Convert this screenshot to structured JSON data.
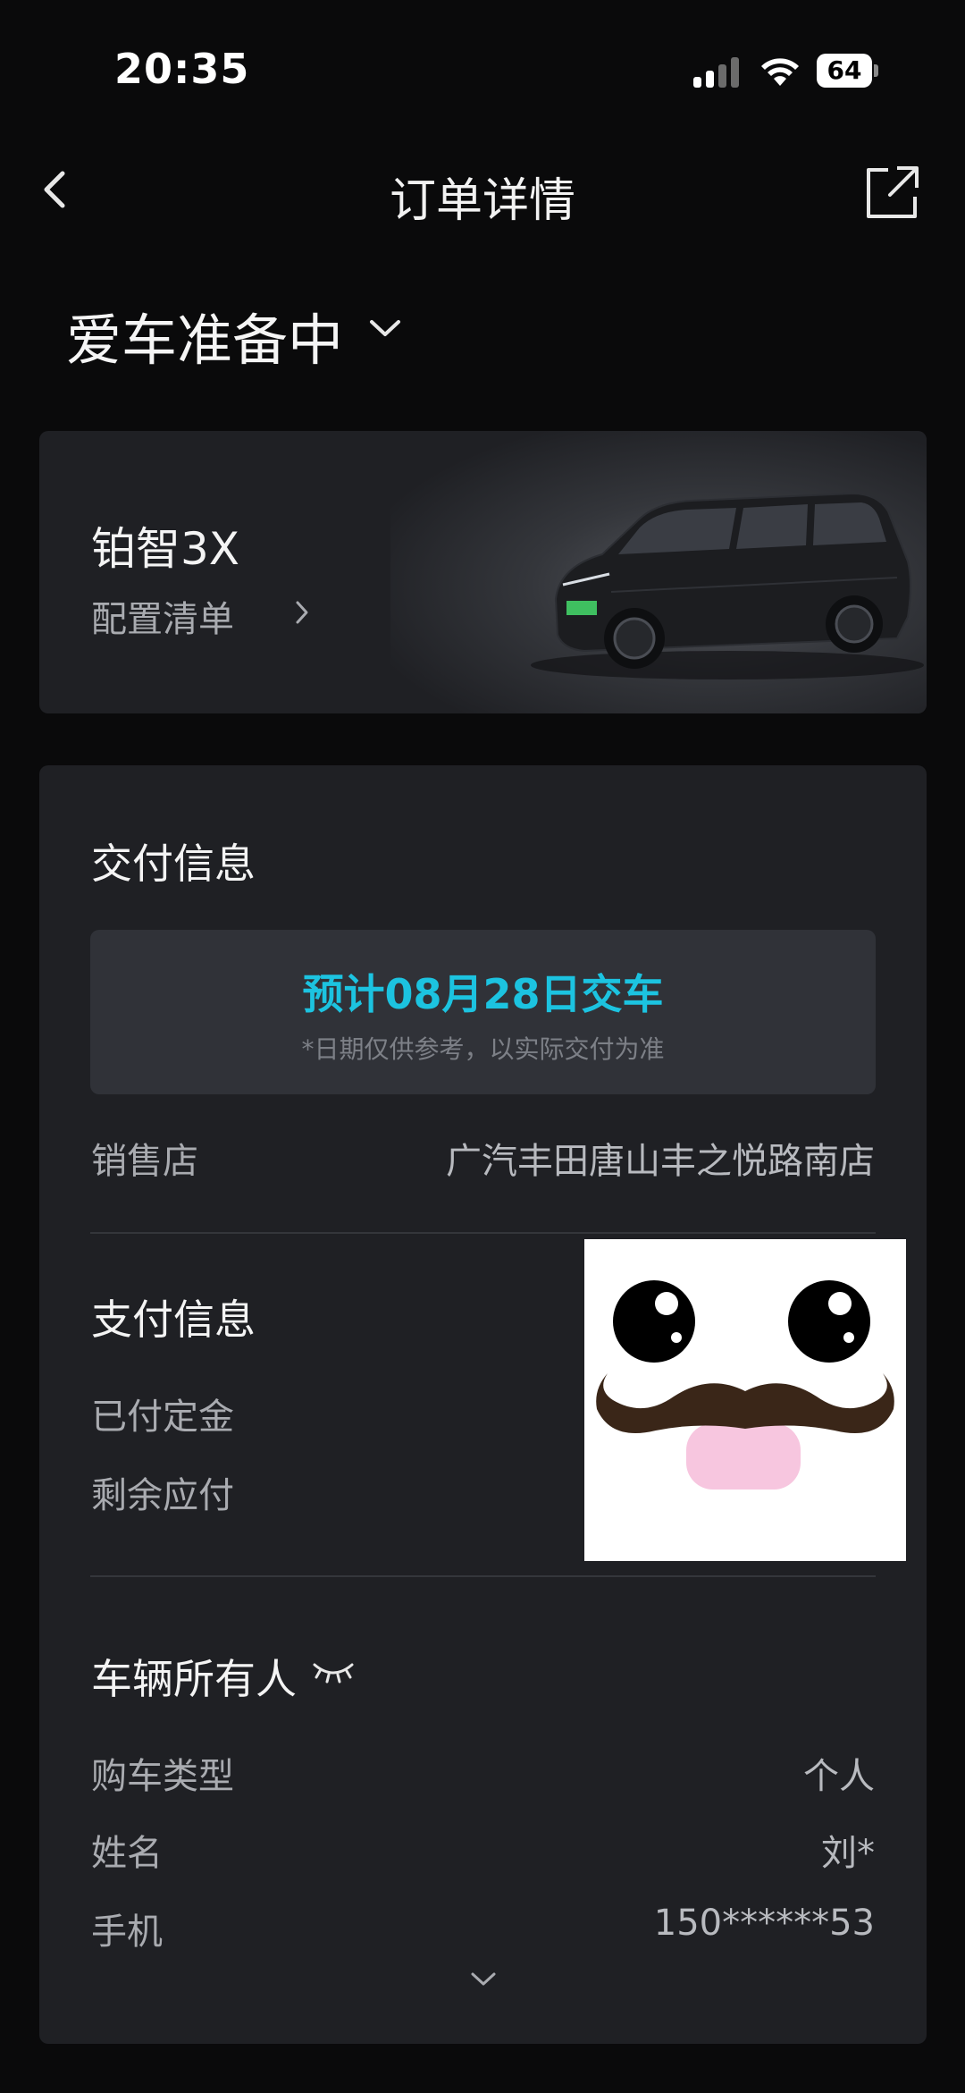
{
  "status_bar": {
    "time": "20:35",
    "battery": "64"
  },
  "nav": {
    "title": "订单详情"
  },
  "order": {
    "status": "爱车准备中"
  },
  "car": {
    "name": "铂智3X",
    "config_link": "配置清单",
    "badge_text": "铂智3X"
  },
  "delivery": {
    "title": "交付信息",
    "date_text": "预计08月28日交车",
    "note": "*日期仅供参考，以实际交付为准",
    "store_label": "销售店",
    "store_value": "广汽丰田唐山丰之悦路南店"
  },
  "payment": {
    "title": "支付信息",
    "deposit_label": "已付定金",
    "remaining_label": "剩余应付"
  },
  "owner": {
    "title": "车辆所有人",
    "type_label": "购车类型",
    "type_value": "个人",
    "name_label": "姓名",
    "name_value": "刘*",
    "phone_label": "手机",
    "phone_value": "150******53"
  },
  "colors": {
    "background": "#0a0a0b",
    "card": "#1f2024",
    "accent": "#1cc3e0",
    "muted_text": "#a9abb0"
  }
}
